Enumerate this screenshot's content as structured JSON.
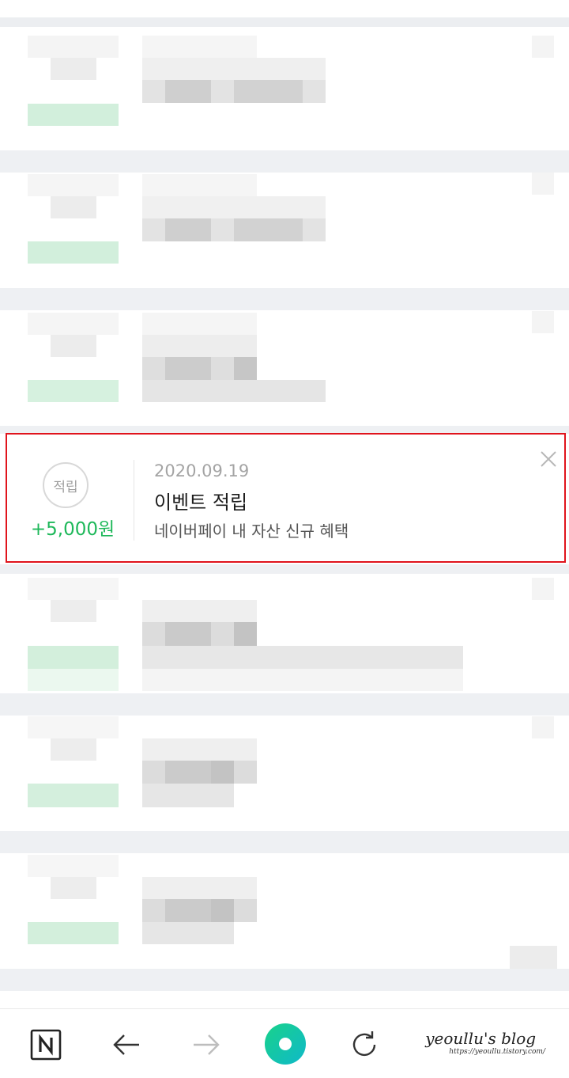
{
  "highlighted_item": {
    "badge_label": "적립",
    "amount": "+5,000원",
    "date": "2020.09.19",
    "title": "이벤트 적립",
    "description": "네이버페이 내 자산 신규 혜택"
  },
  "colors": {
    "highlight_border": "#e0141c",
    "amount_green": "#1eb85a",
    "nav_green_start": "#19d28a",
    "nav_green_end": "#0fb9c9"
  },
  "bottom_nav": {
    "items": [
      {
        "name": "naver-home",
        "icon": "naver-n-icon"
      },
      {
        "name": "back",
        "icon": "arrow-left-icon"
      },
      {
        "name": "forward",
        "icon": "arrow-right-icon"
      },
      {
        "name": "green-dot",
        "icon": "green-dot-icon"
      },
      {
        "name": "refresh",
        "icon": "refresh-icon"
      }
    ]
  },
  "watermark": {
    "title": "yeoullu's blog",
    "url": "https://yeoullu.tistory.com/"
  }
}
